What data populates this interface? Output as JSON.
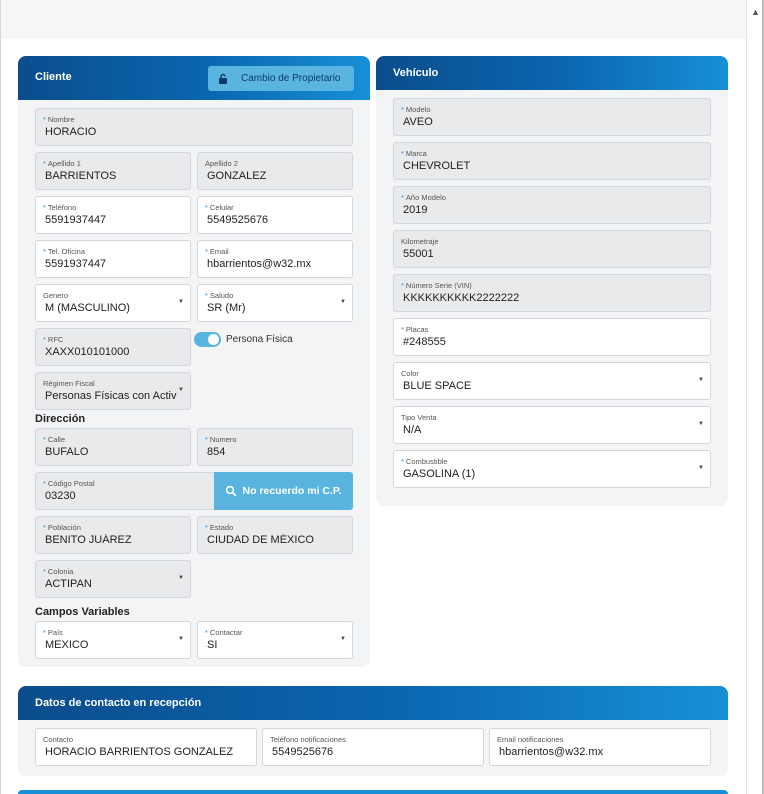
{
  "scroll": {
    "up_arrow": "▲"
  },
  "cliente": {
    "title": "Cliente",
    "change_owner_label": "Cambio de Propietario",
    "nombre": {
      "label": "Nombre",
      "value": "HORACIO"
    },
    "apellido1": {
      "label": "Apellido 1",
      "value": "BARRIENTOS"
    },
    "apellido2": {
      "label": "Apellido 2",
      "value": "GONZALEZ"
    },
    "telefono": {
      "label": "Teléfono",
      "value": "5591937447"
    },
    "celular": {
      "label": "Celular",
      "value": "5549525676"
    },
    "tel_oficina": {
      "label": "Tel. Oficina",
      "value": "5591937447"
    },
    "email": {
      "label": "Email",
      "value": "hbarrientos@w32.mx"
    },
    "genero": {
      "label": "Genero",
      "value": "M (MASCULINO)"
    },
    "saludo": {
      "label": "Saludo",
      "value": "SR (Mr)"
    },
    "rfc": {
      "label": "RFC",
      "value": "XAXX010101000"
    },
    "persona_fisica": {
      "label": "Persona Física",
      "checked": true
    },
    "regimen": {
      "label": "Régimen Fiscal",
      "value": "Personas Físicas con Activ"
    },
    "direccion_title": "Dirección",
    "calle": {
      "label": "Calle",
      "value": "BUFALO"
    },
    "numero": {
      "label": "Numero",
      "value": "854"
    },
    "codigo_postal": {
      "label": "Código Postal",
      "value": "03230"
    },
    "cp_button_label": "No recuerdo mi C.P.",
    "poblacion": {
      "label": "Población",
      "value": "BENITO JUÁREZ"
    },
    "estado": {
      "label": "Estado",
      "value": "CIUDAD DE MÉXICO"
    },
    "colonia": {
      "label": "Colonia",
      "value": "ACTIPAN"
    },
    "campos_title": "Campos Variables",
    "pais": {
      "label": "País",
      "value": "MEXICO"
    },
    "contactar": {
      "label": "Contactar",
      "value": "SI"
    }
  },
  "vehiculo": {
    "title": "Vehículo",
    "modelo": {
      "label": "Modelo",
      "value": "AVEO"
    },
    "marca": {
      "label": "Marca",
      "value": "CHEVROLET"
    },
    "anio": {
      "label": "Año Modelo",
      "value": "2019"
    },
    "kilometraje": {
      "label": "Kilometraje",
      "value": "55001"
    },
    "vin": {
      "label": "Número Serie (VIN)",
      "value": "KKKKKKKKKK2222222"
    },
    "placas": {
      "label": "Placas",
      "value": "#248555"
    },
    "color": {
      "label": "Color",
      "value": "BLUE SPACE"
    },
    "tipo_venta": {
      "label": "Tipo Venta",
      "value": "N/A"
    },
    "combustible": {
      "label": "Combustible",
      "value": "GASOLINA (1)"
    }
  },
  "contacto": {
    "title": "Datos de contacto en recepción",
    "contacto": {
      "label": "Contacto",
      "value": "HORACIO BARRIENTOS GONZALEZ"
    },
    "telefono": {
      "label": "Teléfono notificaciones",
      "value": "5549525676"
    },
    "email": {
      "label": "Email notificaciones",
      "value": "hbarrientos@w32.mx"
    }
  },
  "colors": {
    "header_start": "#0a4d8c",
    "header_end": "#1790d8",
    "accent": "#5ab4e0",
    "card_bg": "#f3f4f6"
  },
  "icons": {
    "lock": "lock-icon",
    "search": "search-icon",
    "caret": "caret-down-icon"
  }
}
